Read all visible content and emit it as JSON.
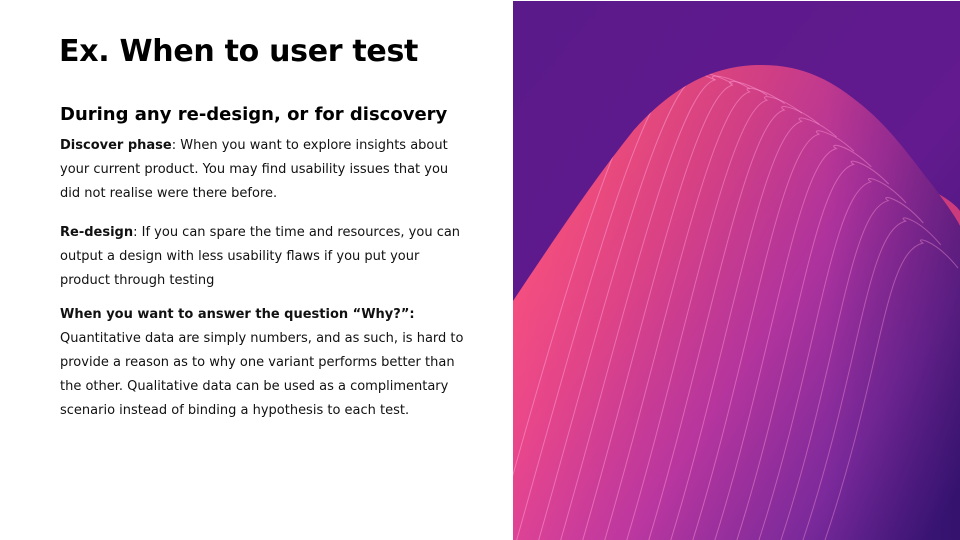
{
  "slide": {
    "title": "Ex. When to user test",
    "subtitle": "During any re-design, or for discovery",
    "paragraphs": [
      {
        "lead": "Discover phase",
        "sep": ": ",
        "text": "When you want to explore insights about your current product. You may find usability issues that you did not realise were there before."
      },
      {
        "lead": "Re-design",
        "sep": ": ",
        "text": "If you can spare the time and resources, you can output a design with less usability flaws if you put your product through testing"
      },
      {
        "lead": "When you want to answer the question “Why?”:",
        "sep": " ",
        "text": "Quantitative data are simply numbers, and as such, is hard to provide a reason as to why one variant performs better than the other. Qualitative data can be used as a complimentary scenario instead of binding a hypothesis to each test."
      }
    ]
  },
  "colors": {
    "background_purple": "#5e1a8c",
    "wave_pink": "#f24f78",
    "wave_magenta": "#c83ca6",
    "wave_violet": "#7a2a9e"
  },
  "decoration": {
    "image": "abstract-gradient-wave-art"
  }
}
